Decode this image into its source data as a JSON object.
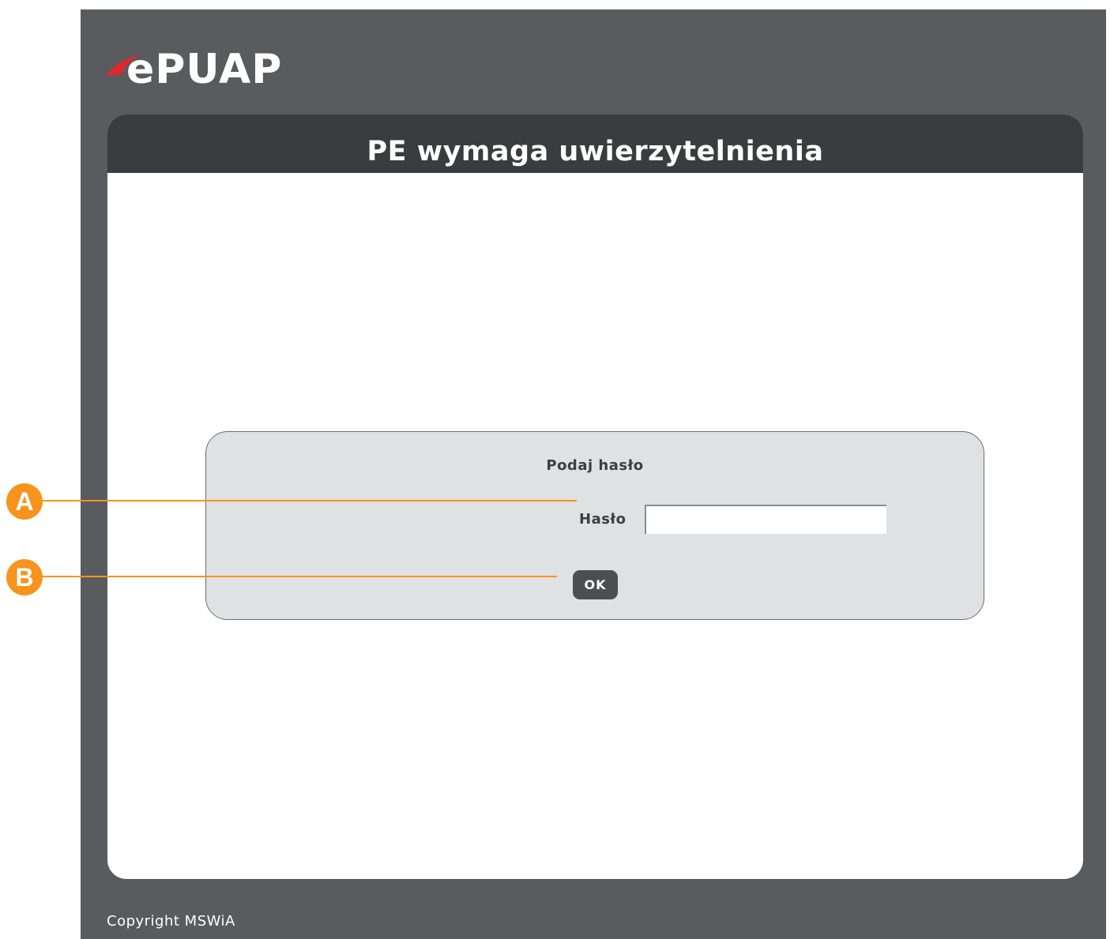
{
  "logo": {
    "text": "ePUAP",
    "accent_color": "#e3262d"
  },
  "header": {
    "title": "PE wymaga uwierzytelnienia"
  },
  "login": {
    "heading": "Podaj hasło",
    "password_label": "Hasło",
    "password_value": "",
    "ok_label": "OK"
  },
  "footer": {
    "copyright": "Copyright MSWiA"
  },
  "callouts": [
    {
      "letter": "A"
    },
    {
      "letter": "B"
    }
  ],
  "colors": {
    "frame": "#595b5e",
    "header": "#3b3c3e",
    "callout": "#f7941d"
  }
}
